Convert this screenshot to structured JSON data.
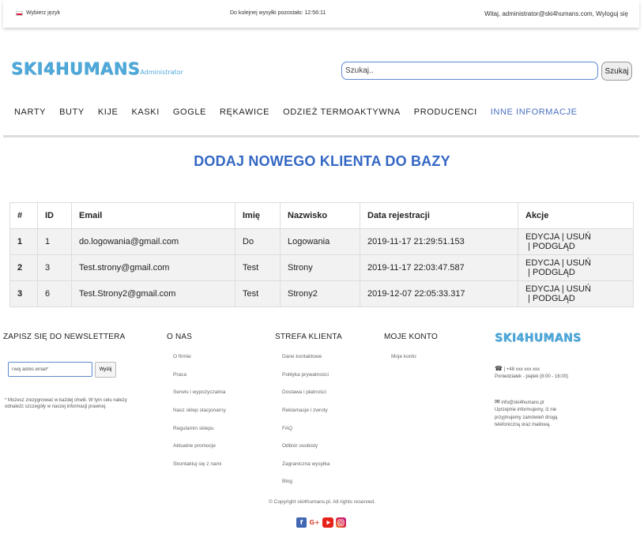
{
  "topbar": {
    "language": "Wybierz język",
    "timer": "Do kolejnej wysyłki pozostało: 12:56:11",
    "welcome": "Witaj, administrator@ski4humans.com, Wyloguj się"
  },
  "header": {
    "logo": "SKI4HUMANS",
    "logo_sub": "Administrator",
    "search_placeholder": "Szukaj..",
    "search_button": "Szukaj"
  },
  "nav": [
    "NARTY",
    "BUTY",
    "KIJE",
    "KASKI",
    "GOGLE",
    "RĘKAWICE",
    "ODZIEŻ TERMOAKTYWNA",
    "PRODUCENCI",
    "INNE INFORMACJE"
  ],
  "page_title": "DODAJ NOWEGO KLIENTA DO BAZY",
  "table": {
    "headers": [
      "#",
      "ID",
      "Email",
      "Imię",
      "Nazwisko",
      "Data rejestracji",
      "Akcje"
    ],
    "rows": [
      {
        "num": "1",
        "id": "1",
        "email": "do.logowania@gmail.com",
        "first": "Do",
        "last": "Logowania",
        "date": "2019-11-17 21:29:51.153"
      },
      {
        "num": "2",
        "id": "3",
        "email": "Test.strony@gmail.com",
        "first": "Test",
        "last": "Strony",
        "date": "2019-11-17 22:03:47.587"
      },
      {
        "num": "3",
        "id": "6",
        "email": "Test.Strony2@gmail.com",
        "first": "Test",
        "last": "Strony2",
        "date": "2019-12-07 22:05:33.317"
      }
    ],
    "actions": {
      "edit": "EDYCJA",
      "delete": "USUŃ",
      "preview": "PODGLĄD",
      "sep": " | "
    }
  },
  "footer": {
    "newsletter": {
      "title": "ZAPISZ SIĘ DO NEWSLETTERA",
      "placeholder": "Twój adres email*",
      "button": "Wyślij",
      "note": "* Możesz zrezygnować w każdej chwili. W tym celu należy odnaleźć szczegóły w naszej informacji prawnej."
    },
    "onas": {
      "title": "O NAS",
      "links": [
        "O firmie",
        "Praca",
        "Serwis i wypożyczalnia",
        "Nasz sklep stacjonarny",
        "Regulamin sklepu",
        "Aktualne promocje",
        "Skontaktuj się z nami"
      ]
    },
    "strefa": {
      "title": "STREFA KLIENTA",
      "links": [
        "Dane kontaktowe",
        "Polityka prywatności",
        "Dostawa i płatności",
        "Reklamacje i zwroty",
        "FAQ",
        "Odbiór osobisty",
        "Zagraniczna wysyłka",
        "Blog"
      ]
    },
    "konto": {
      "title": "MOJE KONTO",
      "links": [
        "Moje konto"
      ]
    },
    "contact": {
      "logo": "SKI4HUMANS",
      "phone": "| +48 xxx xxx xxx",
      "hours": "Poniedziałek - piątek (8:00 - 16:00)",
      "email": "info@ski4humans.pl",
      "email_note": "Uprzejmie informujemy, iż nie przyjmujemy zamówień drogą telefoniczną oraz mailową."
    },
    "copyright": "© Copyright ski4humans.pl. All rights reserved."
  },
  "colors": {
    "brand": "#4fa9d9",
    "title": "#3467c4",
    "active_nav": "#4a70c4"
  }
}
